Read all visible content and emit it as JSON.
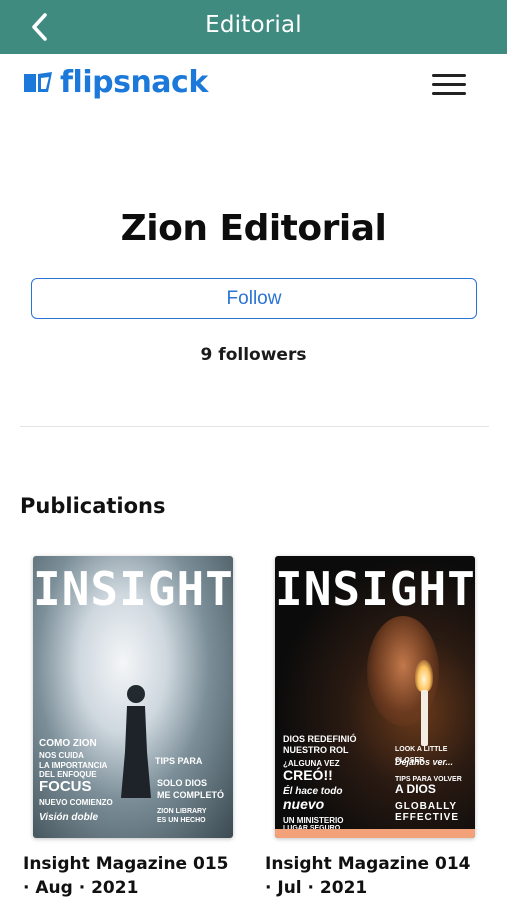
{
  "topbar": {
    "title": "Editorial",
    "back_icon": "chevron-left-icon",
    "background_color": "#3f8b80"
  },
  "brand": {
    "logo_text": "flipsnack",
    "logo_icon": "flipbook-icon",
    "menu_icon": "hamburger-menu-icon",
    "brand_color": "#1c78d9"
  },
  "profile": {
    "name": "Zion Editorial",
    "follow_label": "Follow",
    "followers_text": "9 followers"
  },
  "publications": {
    "heading": "Publications",
    "items": [
      {
        "title": "Insight Magazine 015 · Aug · 2021",
        "cover_masthead": "INSIGHT",
        "cover_lines": [
          "COMO ZION",
          "NOS CUIDA",
          "LA IMPORTANCIA",
          "DEL ENFOQUE",
          "FOCUS",
          "NUEVO COMIENZO",
          "Visión doble",
          "TIPS PARA",
          "SOLO DIOS",
          "ME COMPLETÓ",
          "ZION LIBRARY",
          "ES UN HECHO"
        ]
      },
      {
        "title": "Insight Magazine 014 · Jul · 2021",
        "cover_masthead": "INSIGHT",
        "cover_lines": [
          "DIOS REDEFINIÓ",
          "NUESTRO ROL",
          "¿ALGUNA VEZ",
          "CREÓ!!",
          "Él hace todo",
          "nuevo",
          "UN MINISTERIO",
          "LUGAR SEGURO",
          "LOOK A LITTLE CLOSER",
          "Déjanos ver...",
          "TIPS PARA VOLVER",
          "A DIOS",
          "GLOBALLY",
          "EFFECTIVE"
        ]
      }
    ]
  }
}
